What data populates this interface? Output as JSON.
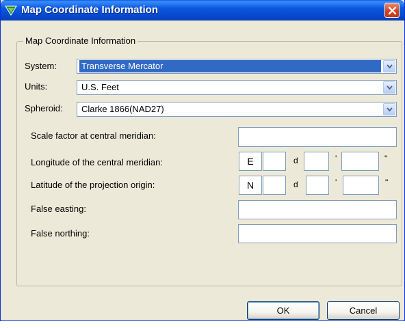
{
  "window": {
    "title": "Map Coordinate Information"
  },
  "group": {
    "legend": "Map Coordinate Information"
  },
  "system": {
    "label": "System:",
    "value": "Transverse Mercator"
  },
  "units": {
    "label": "Units:",
    "value": "U.S. Feet"
  },
  "spheroid": {
    "label": "Spheroid:",
    "value": "Clarke 1866(NAD27)"
  },
  "params": {
    "scale_factor_label": "Scale factor at central meridian:",
    "scale_factor_value": "",
    "longitude_label": "Longitude of the central meridian:",
    "longitude_dir": "E",
    "longitude_deg": "",
    "longitude_min": "",
    "longitude_sec": "",
    "latitude_label": "Latitude of the projection origin:",
    "latitude_dir": "N",
    "latitude_deg": "",
    "latitude_min": "",
    "latitude_sec": "",
    "false_easting_label": "False easting:",
    "false_easting_value": "",
    "false_northing_label": "False northing:",
    "false_northing_value": "",
    "deg_unit": "d",
    "min_unit": "'",
    "sec_unit": "\""
  },
  "buttons": {
    "ok": "OK",
    "cancel": "Cancel"
  }
}
